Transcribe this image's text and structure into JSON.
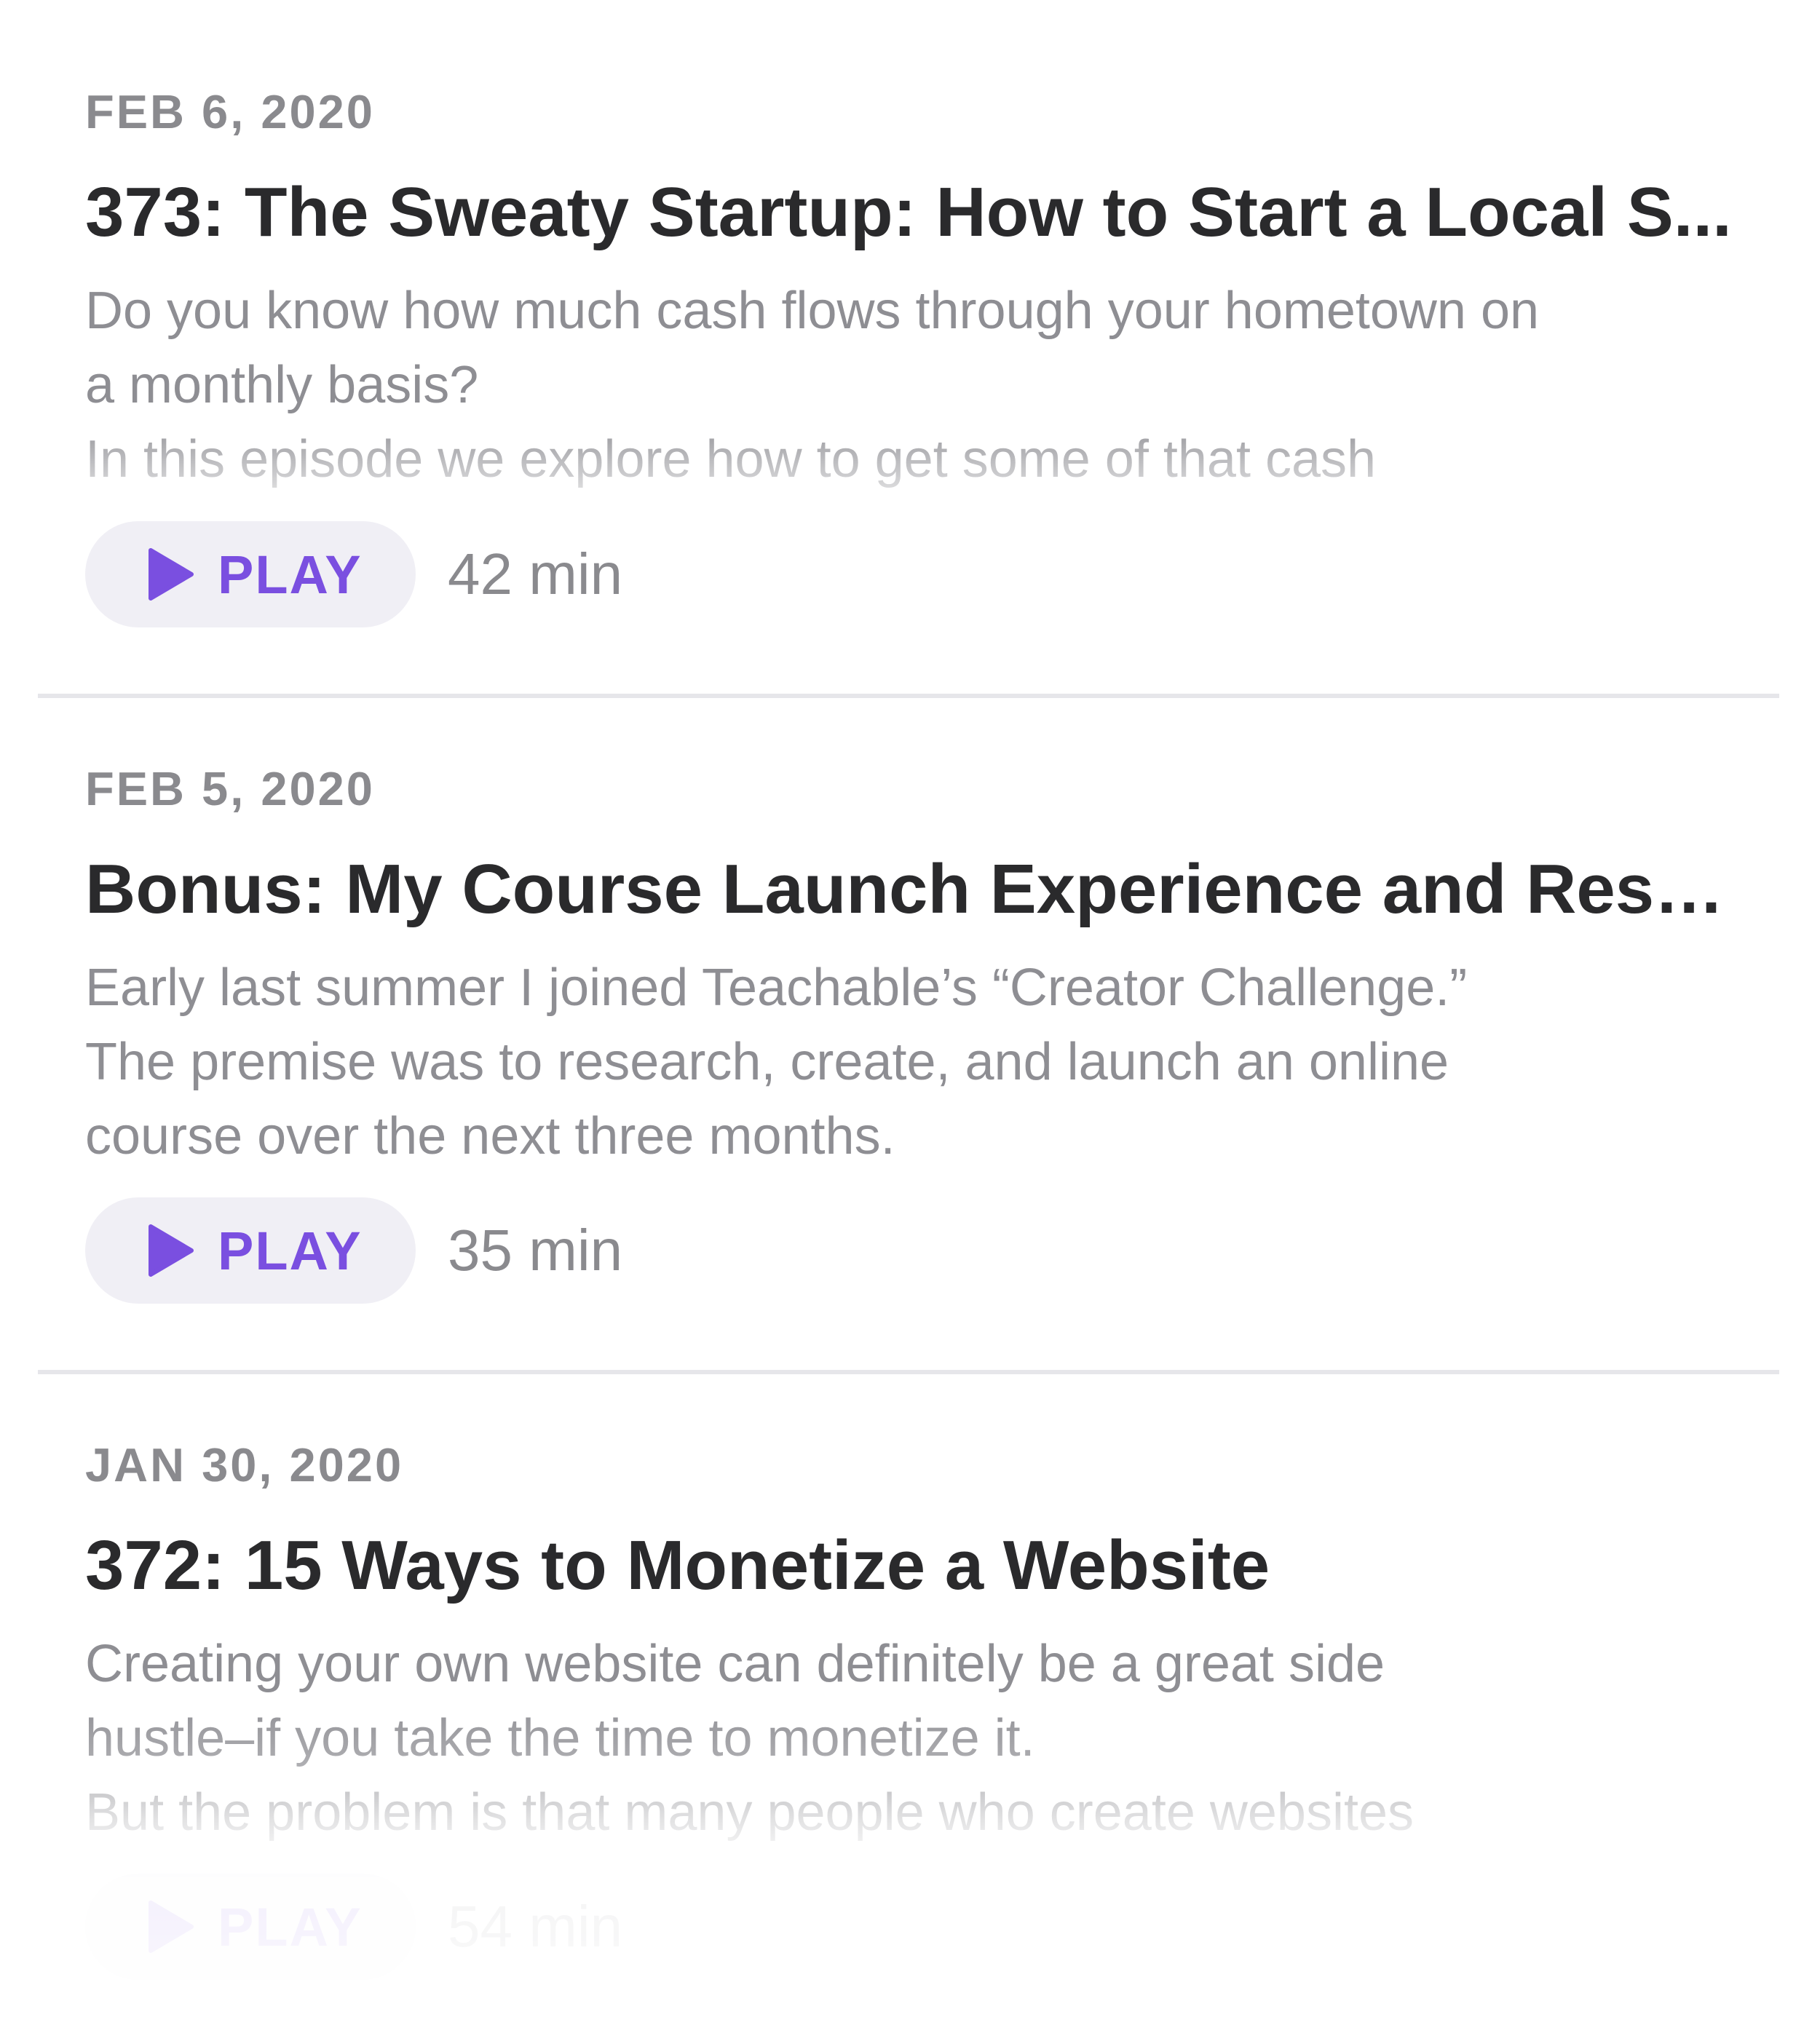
{
  "episodes": [
    {
      "date": "FEB 6, 2020",
      "title": "373: The Sweaty Startup: How to Start a Local S...",
      "description": "Do you know how much cash flows through your hometown on\na monthly basis?\nIn this episode we explore how to get some of that cash",
      "play_label": "PLAY",
      "duration": "42 min"
    },
    {
      "date": "FEB 5, 2020",
      "title": "Bonus: My Course Launch Experience and Results",
      "description": "Early last summer I joined Teachable’s “Creator Challenge.”\nThe premise was to research, create, and launch an online\ncourse over the next three months.",
      "play_label": "PLAY",
      "duration": "35 min"
    },
    {
      "date": "JAN 30, 2020",
      "title": "372: 15 Ways to Monetize a Website",
      "description": "Creating your own website can definitely be a great side\nhustle–if you take the time to monetize it.\nBut the problem is that many people who create websites",
      "play_label": "PLAY",
      "duration": "54 min"
    }
  ],
  "colors": {
    "accent": "#7a4fe0",
    "play_button_bg": "#f0eff5",
    "date_text": "#8a8a8e",
    "title_text": "#2a2a2c",
    "description_text": "#8e8e93",
    "divider": "#e6e6ea"
  },
  "icons": {
    "play": "play-triangle-icon"
  }
}
